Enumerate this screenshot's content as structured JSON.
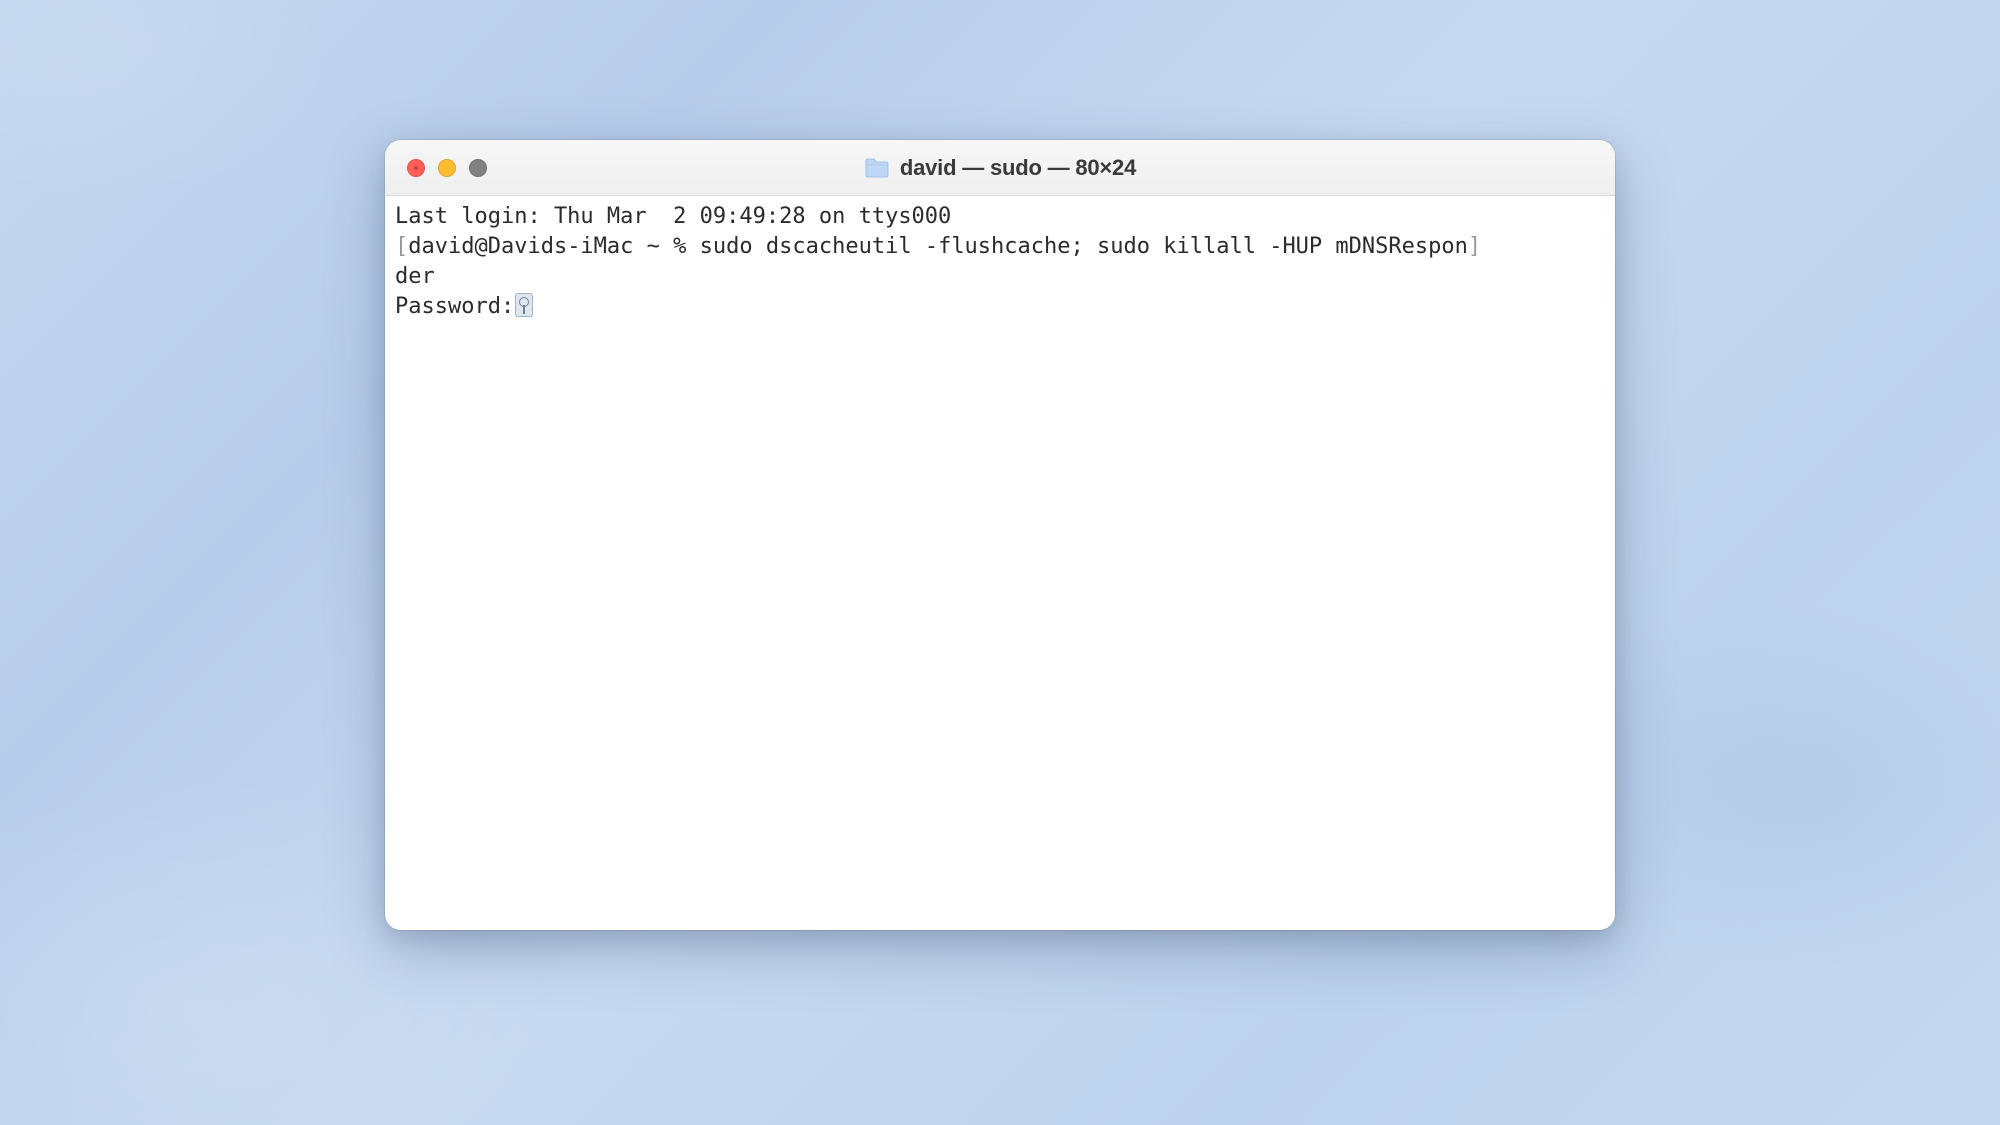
{
  "window": {
    "title": "david — sudo — 80×24",
    "traffic": {
      "close": "close-window",
      "minimize": "minimize-window",
      "maximize": "maximize-window"
    }
  },
  "terminal": {
    "last_login": "Last login: Thu Mar  2 09:49:28 on ttys000",
    "bracket_open": "[",
    "prompt": "david@Davids-iMac ~ % ",
    "command": "sudo dscacheutil -flushcache; sudo killall -HUP mDNSRespon",
    "bracket_close": "]",
    "command_wrap": "der",
    "password_label": "Password:",
    "password_icon": "key-icon"
  }
}
